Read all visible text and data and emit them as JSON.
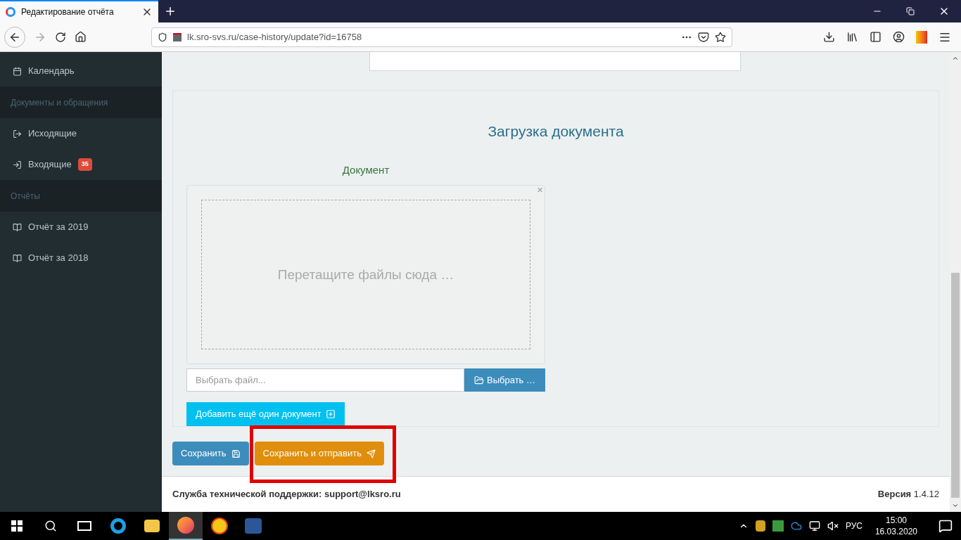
{
  "browser": {
    "tab_title": "Редактирование отчёта",
    "url": "lk.sro-svs.ru/case-history/update?id=16758"
  },
  "sidebar": {
    "items": [
      {
        "kind": "calendar",
        "label": "Календарь"
      },
      {
        "kind": "header",
        "label": "Документы и обращения"
      },
      {
        "kind": "outgoing",
        "label": "Исходящие"
      },
      {
        "kind": "incoming",
        "label": "Входящие",
        "badge": "35"
      },
      {
        "kind": "header",
        "label": "Отчёты"
      },
      {
        "kind": "report",
        "label": "Отчёт за 2019"
      },
      {
        "kind": "report",
        "label": "Отчёт за 2018"
      }
    ]
  },
  "upload": {
    "title": "Загрузка документа",
    "field_label": "Документ",
    "dropzone_text": "Перетащите файлы сюда …",
    "close": "×",
    "file_placeholder": "Выбрать файл...",
    "browse_button": "Выбрать …",
    "add_button": "Добавить ещё один документ"
  },
  "actions": [
    {
      "kind": "save",
      "label": "Сохранить"
    },
    {
      "kind": "send",
      "label": "Сохранить и отправить",
      "highlighted": true
    }
  ],
  "footer": {
    "support_label": "Служба технической поддержки:",
    "support_email": "support@lksro.ru",
    "version_label": "Версия",
    "version": "1.4.12"
  },
  "taskbar": {
    "language": "РУС",
    "time": "15:00",
    "date": "16.03.2020"
  }
}
